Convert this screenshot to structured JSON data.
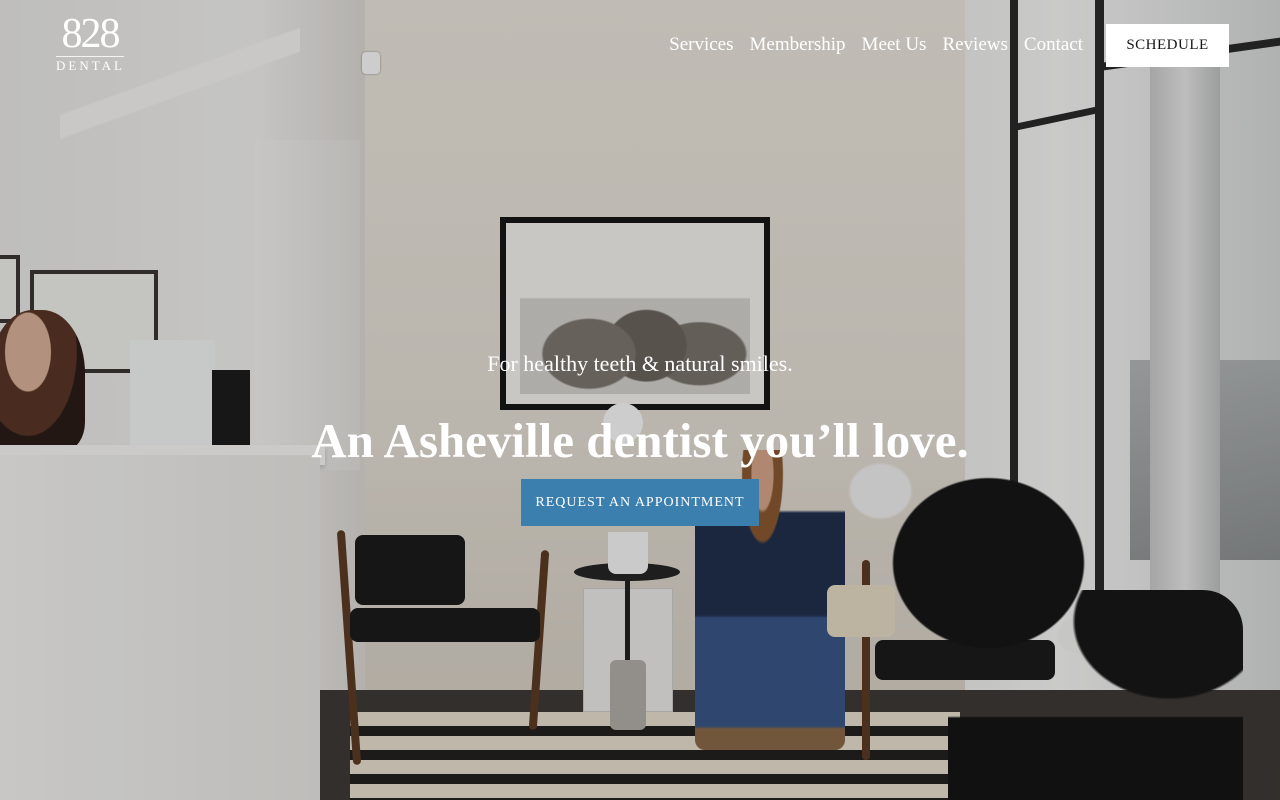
{
  "brand": {
    "logo_mark": "828",
    "logo_sub": "DENTAL"
  },
  "nav": {
    "items": [
      {
        "label": "Services"
      },
      {
        "label": "Membership"
      },
      {
        "label": "Meet Us"
      },
      {
        "label": "Reviews"
      },
      {
        "label": "Contact"
      }
    ],
    "schedule_label": "SCHEDULE"
  },
  "hero": {
    "tagline": "For healthy teeth & natural smiles.",
    "headline": "An Asheville dentist you’ll love.",
    "cta_label": "REQUEST AN APPOINTMENT"
  },
  "colors": {
    "cta_bg": "#3b7fae",
    "schedule_bg": "#ffffff",
    "text_light": "#ffffff"
  }
}
